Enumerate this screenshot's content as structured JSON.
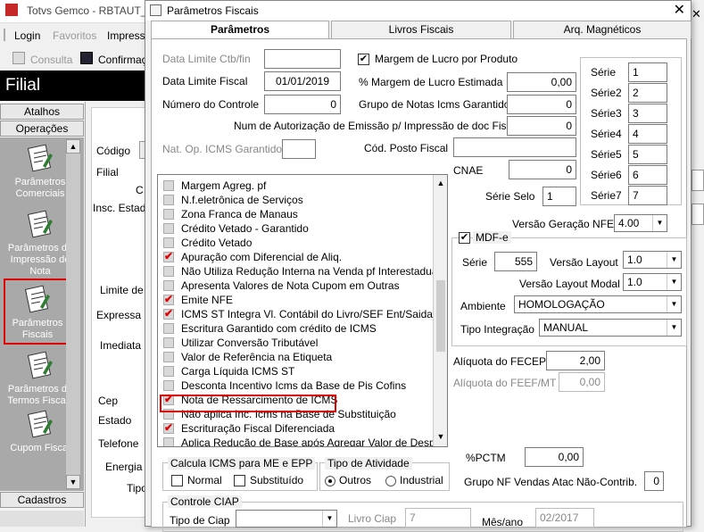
{
  "main_window": {
    "title": "Totvs Gemco - RBTAUT_F",
    "menu": [
      "Login",
      "Favoritos",
      "Impress"
    ],
    "toolbar": [
      "Consulta",
      "Confirmaç"
    ],
    "filial": "Filial",
    "sidebar_tabs": [
      "Atalhos",
      "Operações",
      "Cadastros"
    ],
    "sidebar_items": [
      "Parâmetros Comerciais",
      "Parâmetros de Impressão de Nota",
      "Parâmetros Fiscais",
      "Parâmetros de Termos Fiscais",
      "Cupom Fiscal"
    ],
    "form_labels": {
      "codigo": "Código",
      "filial": "Filial",
      "c": "C",
      "insc_estadual": "Insc. Estadu",
      "limite": "Limite de S",
      "expressa": "Expressa",
      "imediata": "Imediata",
      "cep": "Cep",
      "estado": "Estado",
      "telefone": "Telefone",
      "energia": "Energia E",
      "tipo": "Tipo"
    }
  },
  "dialog": {
    "title": "Parâmetros Fiscais",
    "tabs": [
      "Parâmetros",
      "Livros Fiscais",
      "Arq. Magnéticos"
    ],
    "fields": {
      "data_limite_ctb": {
        "label": "Data Limite Ctb/fin",
        "value": ""
      },
      "data_limite_fiscal": {
        "label": "Data Limite Fiscal",
        "value": "01/01/2019"
      },
      "numero_controle": {
        "label": "Número do Controle",
        "value": "0"
      },
      "margem_lucro_produto": {
        "label": "Margem de Lucro por Produto",
        "checked": true
      },
      "pct_margem_lucro": {
        "label": "% Margem de Lucro Estimada",
        "value": "0,00"
      },
      "grupo_notas_icms": {
        "label": "Grupo de Notas Icms Garantido",
        "value": "0"
      },
      "num_autorizacao": {
        "label": "Num de Autorização de Emissão p/ Impressão de doc Fiscais",
        "value": "0"
      },
      "nat_op_icms": {
        "label": "Nat. Op. ICMS Garantido",
        "value": ""
      },
      "cod_posto_fiscal": {
        "label": "Cód. Posto Fiscal",
        "value": ""
      },
      "cnae": {
        "label": "CNAE",
        "value": "0"
      },
      "serie_selo": {
        "label": "Série Selo",
        "value": "1"
      },
      "versao_geracao_nfe": {
        "label": "Versão Geração NFE",
        "value": "4.00"
      },
      "aliquota_fecep": {
        "label": "Alíquota do FECEP",
        "value": "2,00"
      },
      "aliquota_feef": {
        "label": "Alíquota do FEEF/MT",
        "value": "0,00"
      },
      "pctm": {
        "label": "%PCTM",
        "value": "0,00"
      },
      "grupo_nf_vendas": {
        "label": "Grupo NF Vendas Atac Não-Contrib.",
        "value": "0"
      }
    },
    "series": [
      {
        "label": "Série",
        "value": "1"
      },
      {
        "label": "Série2",
        "value": "2"
      },
      {
        "label": "Série3",
        "value": "3"
      },
      {
        "label": "Série4",
        "value": "4"
      },
      {
        "label": "Série5",
        "value": "5"
      },
      {
        "label": "Série6",
        "value": "6"
      },
      {
        "label": "Série7",
        "value": "7"
      }
    ],
    "check_list": [
      {
        "label": "Margem Agreg. pf",
        "checked": false
      },
      {
        "label": "N.f.eletrônica de Serviços",
        "checked": false
      },
      {
        "label": "Zona Franca de Manaus",
        "checked": false
      },
      {
        "label": "Crédito Vetado - Garantido",
        "checked": false
      },
      {
        "label": "Crédito Vetado",
        "checked": false
      },
      {
        "label": "Apuração com Diferencial de Aliq.",
        "checked": true
      },
      {
        "label": "Não Utiliza Redução Interna na Venda pf Interestadual",
        "checked": false
      },
      {
        "label": "Apresenta Valores de Nota Cupom em Outras",
        "checked": false
      },
      {
        "label": "Emite NFE",
        "checked": true
      },
      {
        "label": "ICMS ST Integra Vl. Contábil do Livro/SEF Ent/Saida",
        "checked": true
      },
      {
        "label": "Escritura Garantido com crédito de ICMS",
        "checked": false
      },
      {
        "label": "Utilizar Conversão Tributável",
        "checked": false
      },
      {
        "label": "Valor de Referência na Etiqueta",
        "checked": false
      },
      {
        "label": "Carga Líquida ICMS ST",
        "checked": false
      },
      {
        "label": "Desconta Incentivo Icms da Base de Pis Cofins",
        "checked": false
      },
      {
        "label": "Nota de Ressarcimento de ICMS",
        "checked": true
      },
      {
        "label": "Não aplica Inc. Icms na Base de Substituição",
        "checked": false
      },
      {
        "label": "Escrituração Fiscal Diferenciada",
        "checked": true
      },
      {
        "label": "Aplica Redução de Base após Agregar Valor de Despesas",
        "checked": false
      }
    ],
    "mdfe": {
      "label": "MDF-e",
      "checked": true,
      "serie_label": "Série",
      "serie_value": "555",
      "versao_layout_label": "Versão Layout",
      "versao_layout_value": "1.0",
      "versao_layout_modal_label": "Versão Layout Modal",
      "versao_layout_modal_value": "1.0",
      "ambiente_label": "Ambiente",
      "ambiente_value": "HOMOLOGAÇÃO",
      "tipo_integracao_label": "Tipo Integração",
      "tipo_integracao_value": "MANUAL"
    },
    "calcula_icms": {
      "title": "Calcula ICMS para ME e EPP",
      "normal": "Normal",
      "substituido": "Substituído"
    },
    "tipo_atividade": {
      "title": "Tipo de Atividade",
      "outros": "Outros",
      "industrial": "Industrial",
      "selected": "Outros"
    },
    "controle_ciap": {
      "title": "Controle CIAP",
      "tipo_ciap_label": "Tipo de Ciap",
      "tipo_ciap_value": "",
      "livro_ciap_label": "Livro Ciap",
      "livro_ciap_value": "7",
      "mes_ano_label": "Mês/ano",
      "mes_ano_value": "02/2017"
    }
  }
}
